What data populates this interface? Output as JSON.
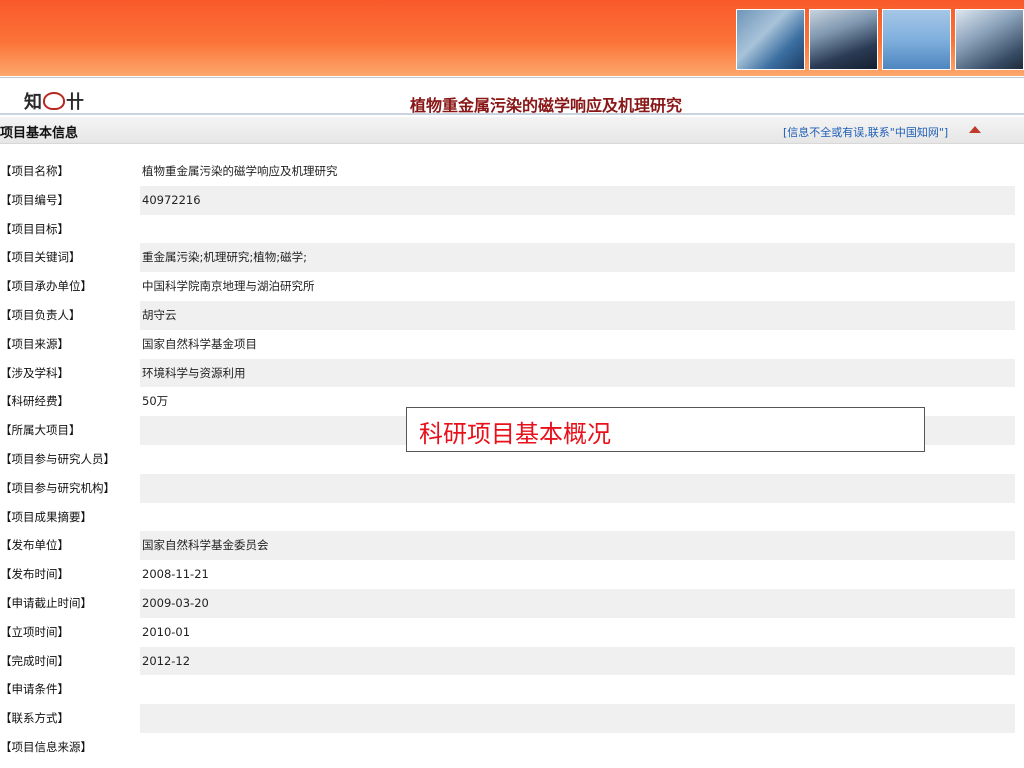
{
  "banner": {
    "photos": [
      {
        "icon": "lab-glassware-photo"
      },
      {
        "icon": "researcher-at-computer-photo"
      },
      {
        "icon": "world-map-photo"
      },
      {
        "icon": "classroom-photo"
      }
    ]
  },
  "header": {
    "logo_text_left": "知",
    "logo_text_right": "卄",
    "title": "植物重金属污染的磁学响应及机理研究"
  },
  "section": {
    "title": "项目基本信息",
    "feedback_link": "[信息不全或有误,联系\"中国知网\"]"
  },
  "rows": [
    {
      "label": "【项目名称】",
      "value": "植物重金属污染的磁学响应及机理研究"
    },
    {
      "label": "【项目编号】",
      "value": "40972216"
    },
    {
      "label": "【项目目标】",
      "value": ""
    },
    {
      "label": "【项目关键词】",
      "value": "重金属污染;机理研究;植物;磁学;"
    },
    {
      "label": "【项目承办单位】",
      "value": "中国科学院南京地理与湖泊研究所"
    },
    {
      "label": "【项目负责人】",
      "value": "胡守云"
    },
    {
      "label": "【项目来源】",
      "value": "国家自然科学基金项目"
    },
    {
      "label": "【涉及学科】",
      "value": "环境科学与资源利用"
    },
    {
      "label": "【科研经费】",
      "value": "50万"
    },
    {
      "label": "【所属大项目】",
      "value": ""
    },
    {
      "label": "【项目参与研究人员】",
      "value": ""
    },
    {
      "label": "【项目参与研究机构】",
      "value": ""
    },
    {
      "label": "【项目成果摘要】",
      "value": ""
    },
    {
      "label": "【发布单位】",
      "value": "国家自然科学基金委员会"
    },
    {
      "label": "【发布时间】",
      "value": "2008-11-21"
    },
    {
      "label": "【申请截止时间】",
      "value": "2009-03-20"
    },
    {
      "label": "【立项时间】",
      "value": "2010-01"
    },
    {
      "label": "【完成时间】",
      "value": "2012-12"
    },
    {
      "label": "【申请条件】",
      "value": ""
    },
    {
      "label": "【联系方式】",
      "value": ""
    },
    {
      "label": "【项目信息来源】",
      "value": ""
    }
  ],
  "overlay": {
    "text": "科研项目基本概况"
  },
  "colors": {
    "banner": "#fb7338",
    "title": "#8a1717",
    "link": "#1f5fb7",
    "overlay_text": "#e8101a"
  }
}
